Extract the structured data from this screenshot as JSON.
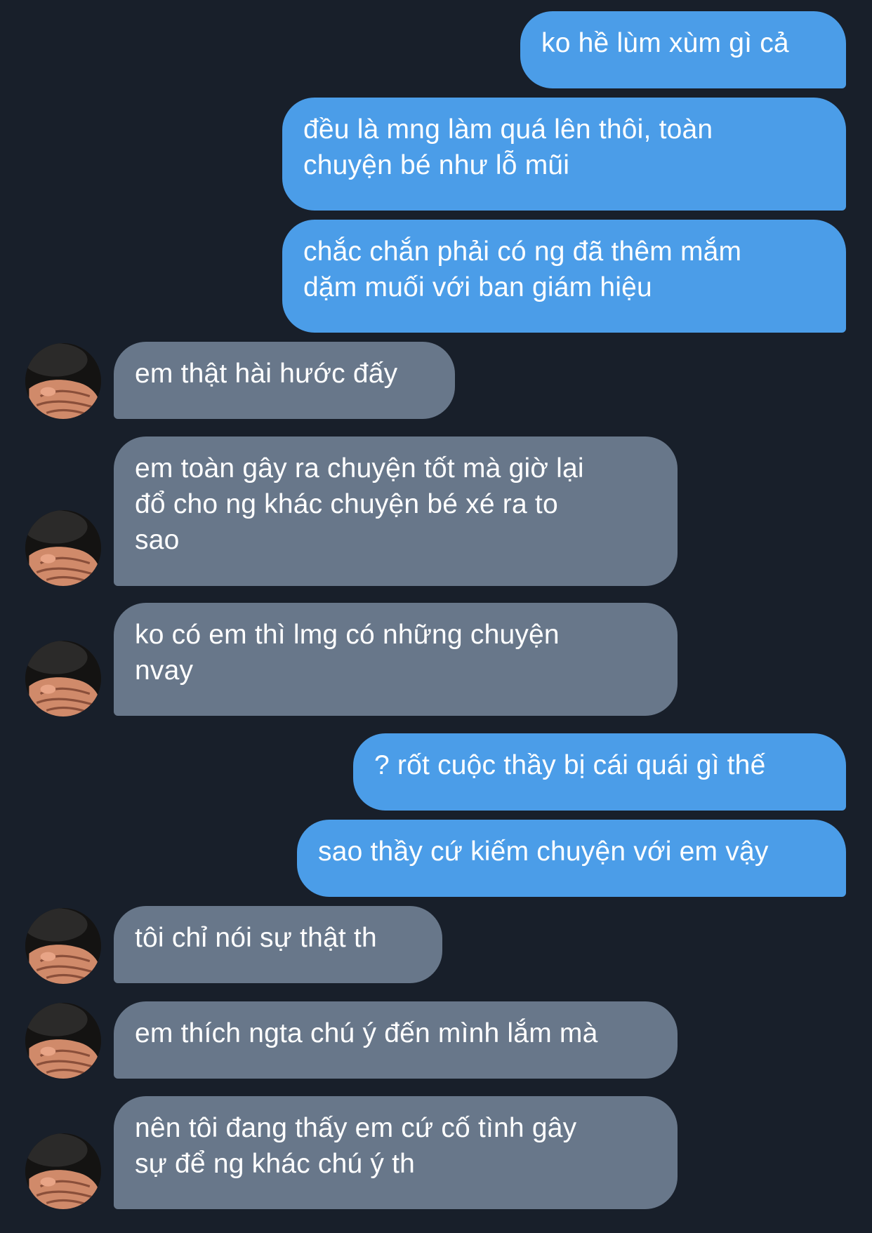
{
  "colors": {
    "background": "#181f2a",
    "outgoing_bubble": "#4b9de8",
    "incoming_bubble": "#68778a",
    "text": "#ffffff"
  },
  "avatar": {
    "icon": "user-avatar-hands-over-face"
  },
  "messages": [
    {
      "side": "outgoing",
      "text": "ko hề lùm xùm gì cả"
    },
    {
      "side": "outgoing",
      "text": "đều là mng làm quá lên thôi, toàn\nchuyện bé như lỗ mũi"
    },
    {
      "side": "outgoing",
      "text": "chắc chắn phải có ng đã thêm mắm\ndặm muối với ban giám hiệu"
    },
    {
      "side": "incoming",
      "text": "em thật hài hước đấy"
    },
    {
      "side": "incoming",
      "text": "em toàn gây ra chuyện tốt mà giờ lại\nđổ cho ng khác chuyện bé xé ra to\nsao"
    },
    {
      "side": "incoming",
      "text": "ko có em thì lmg có những chuyện\nnvay"
    },
    {
      "side": "outgoing",
      "text": "? rốt cuộc thầy bị cái quái gì thế"
    },
    {
      "side": "outgoing",
      "text": "sao thầy cứ kiếm chuyện với em vậy"
    },
    {
      "side": "incoming",
      "text": "tôi chỉ nói sự thật th"
    },
    {
      "side": "incoming",
      "text": "em thích ngta chú ý đến mình lắm mà"
    },
    {
      "side": "incoming",
      "text": "nên tôi đang thấy em cứ cố tình gây\nsự để ng khác chú ý th"
    }
  ]
}
